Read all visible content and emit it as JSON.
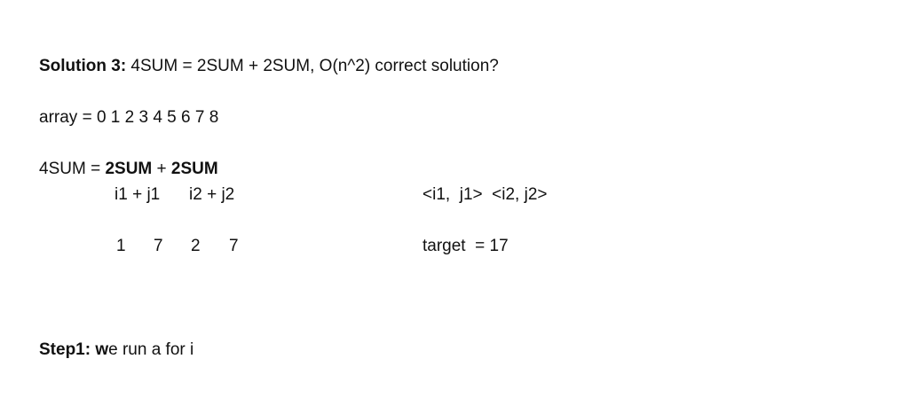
{
  "title": {
    "label": "Solution 3:",
    "text": " 4SUM = 2SUM + 2SUM, O(n^2) correct solution?"
  },
  "array_line": "array = 0 1 2 3 4 5 6 7 8",
  "formula": {
    "prefix": "4SUM = ",
    "left": "2SUM",
    "plus": " + ",
    "right": "2SUM"
  },
  "indices": {
    "left": "i1 + j1",
    "right": "i2 + j2"
  },
  "pairs": "<i1,  j1>  <i2, j2>",
  "values": [
    "1",
    "7",
    "2",
    "7"
  ],
  "target": "target  = 17",
  "step": {
    "label": "Step1: w",
    "text": "e run a for i"
  }
}
